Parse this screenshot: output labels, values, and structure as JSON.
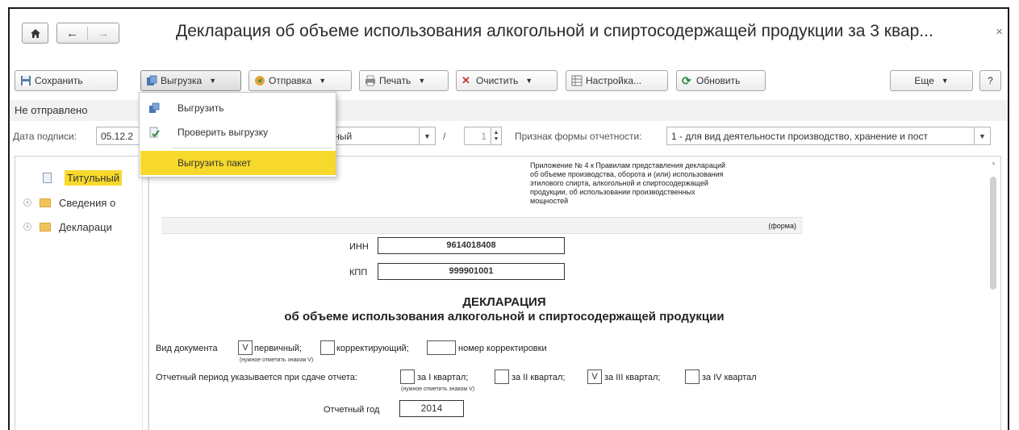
{
  "window": {
    "title": "Декларация об объеме использования алкогольной и спиртосодержащей продукции за 3 квар...",
    "close": "×"
  },
  "nav": {
    "home_icon": "home-icon",
    "back": "←",
    "forward": "→"
  },
  "toolbar": {
    "save": "Сохранить",
    "export": "Выгрузка",
    "send": "Отправка",
    "print": "Печать",
    "clear": "Очистить",
    "settings": "Настройка...",
    "refresh": "Обновить",
    "more": "Еще",
    "help": "?"
  },
  "status": {
    "text": "Не отправлено"
  },
  "params": {
    "sign_date_label": "Дата подписи:",
    "sign_date_value": "05.12.2",
    "doc_type_value": "чный",
    "slash": "/",
    "number_value": "1",
    "form_sign_label": "Признак формы отчетности:",
    "form_sign_value": "1 - для вид деятельности производство, хранение и пост"
  },
  "menu": {
    "items": [
      {
        "label": "Выгрузить"
      },
      {
        "label": "Проверить выгрузку"
      },
      {
        "label": "Выгрузить пакет"
      }
    ]
  },
  "tree": {
    "items": [
      {
        "label": "Титульный"
      },
      {
        "label": "Сведения о"
      },
      {
        "label": "Деклараци"
      }
    ]
  },
  "doc": {
    "appendix_lines": [
      "Приложение № 4 к Правилам представления деклараций",
      "об объеме производства, оборота и (или) использования",
      "этилового спирта, алкогольной и спиртосодержащей",
      "продукции, об использовании производственных",
      "мощностей"
    ],
    "forma": "(форма)",
    "inn_label": "ИНН",
    "inn_value": "9614018408",
    "kpp_label": "КПП",
    "kpp_value": "999901001",
    "heading": "ДЕКЛАРАЦИЯ",
    "subheading": "об объеме использования алкогольной и спиртосодержащей продукции",
    "doc_kind_label": "Вид документа",
    "primary_mark": "V",
    "primary_label": "первичный;",
    "corrective_label": "корректирующий;",
    "correction_num_label": "номер корректировки",
    "hint1": "(нужное отметить знаком V)",
    "period_label": "Отчетный период указывается при сдаче отчета:",
    "q1": "за I квартал;",
    "q2": "за II квартал;",
    "q3_mark": "V",
    "q3": "за III квартал;",
    "q4": "за IV квартал",
    "hint2": "(нужное отметить знаком V)",
    "year_label": "Отчетный год",
    "year_value": "2014"
  }
}
